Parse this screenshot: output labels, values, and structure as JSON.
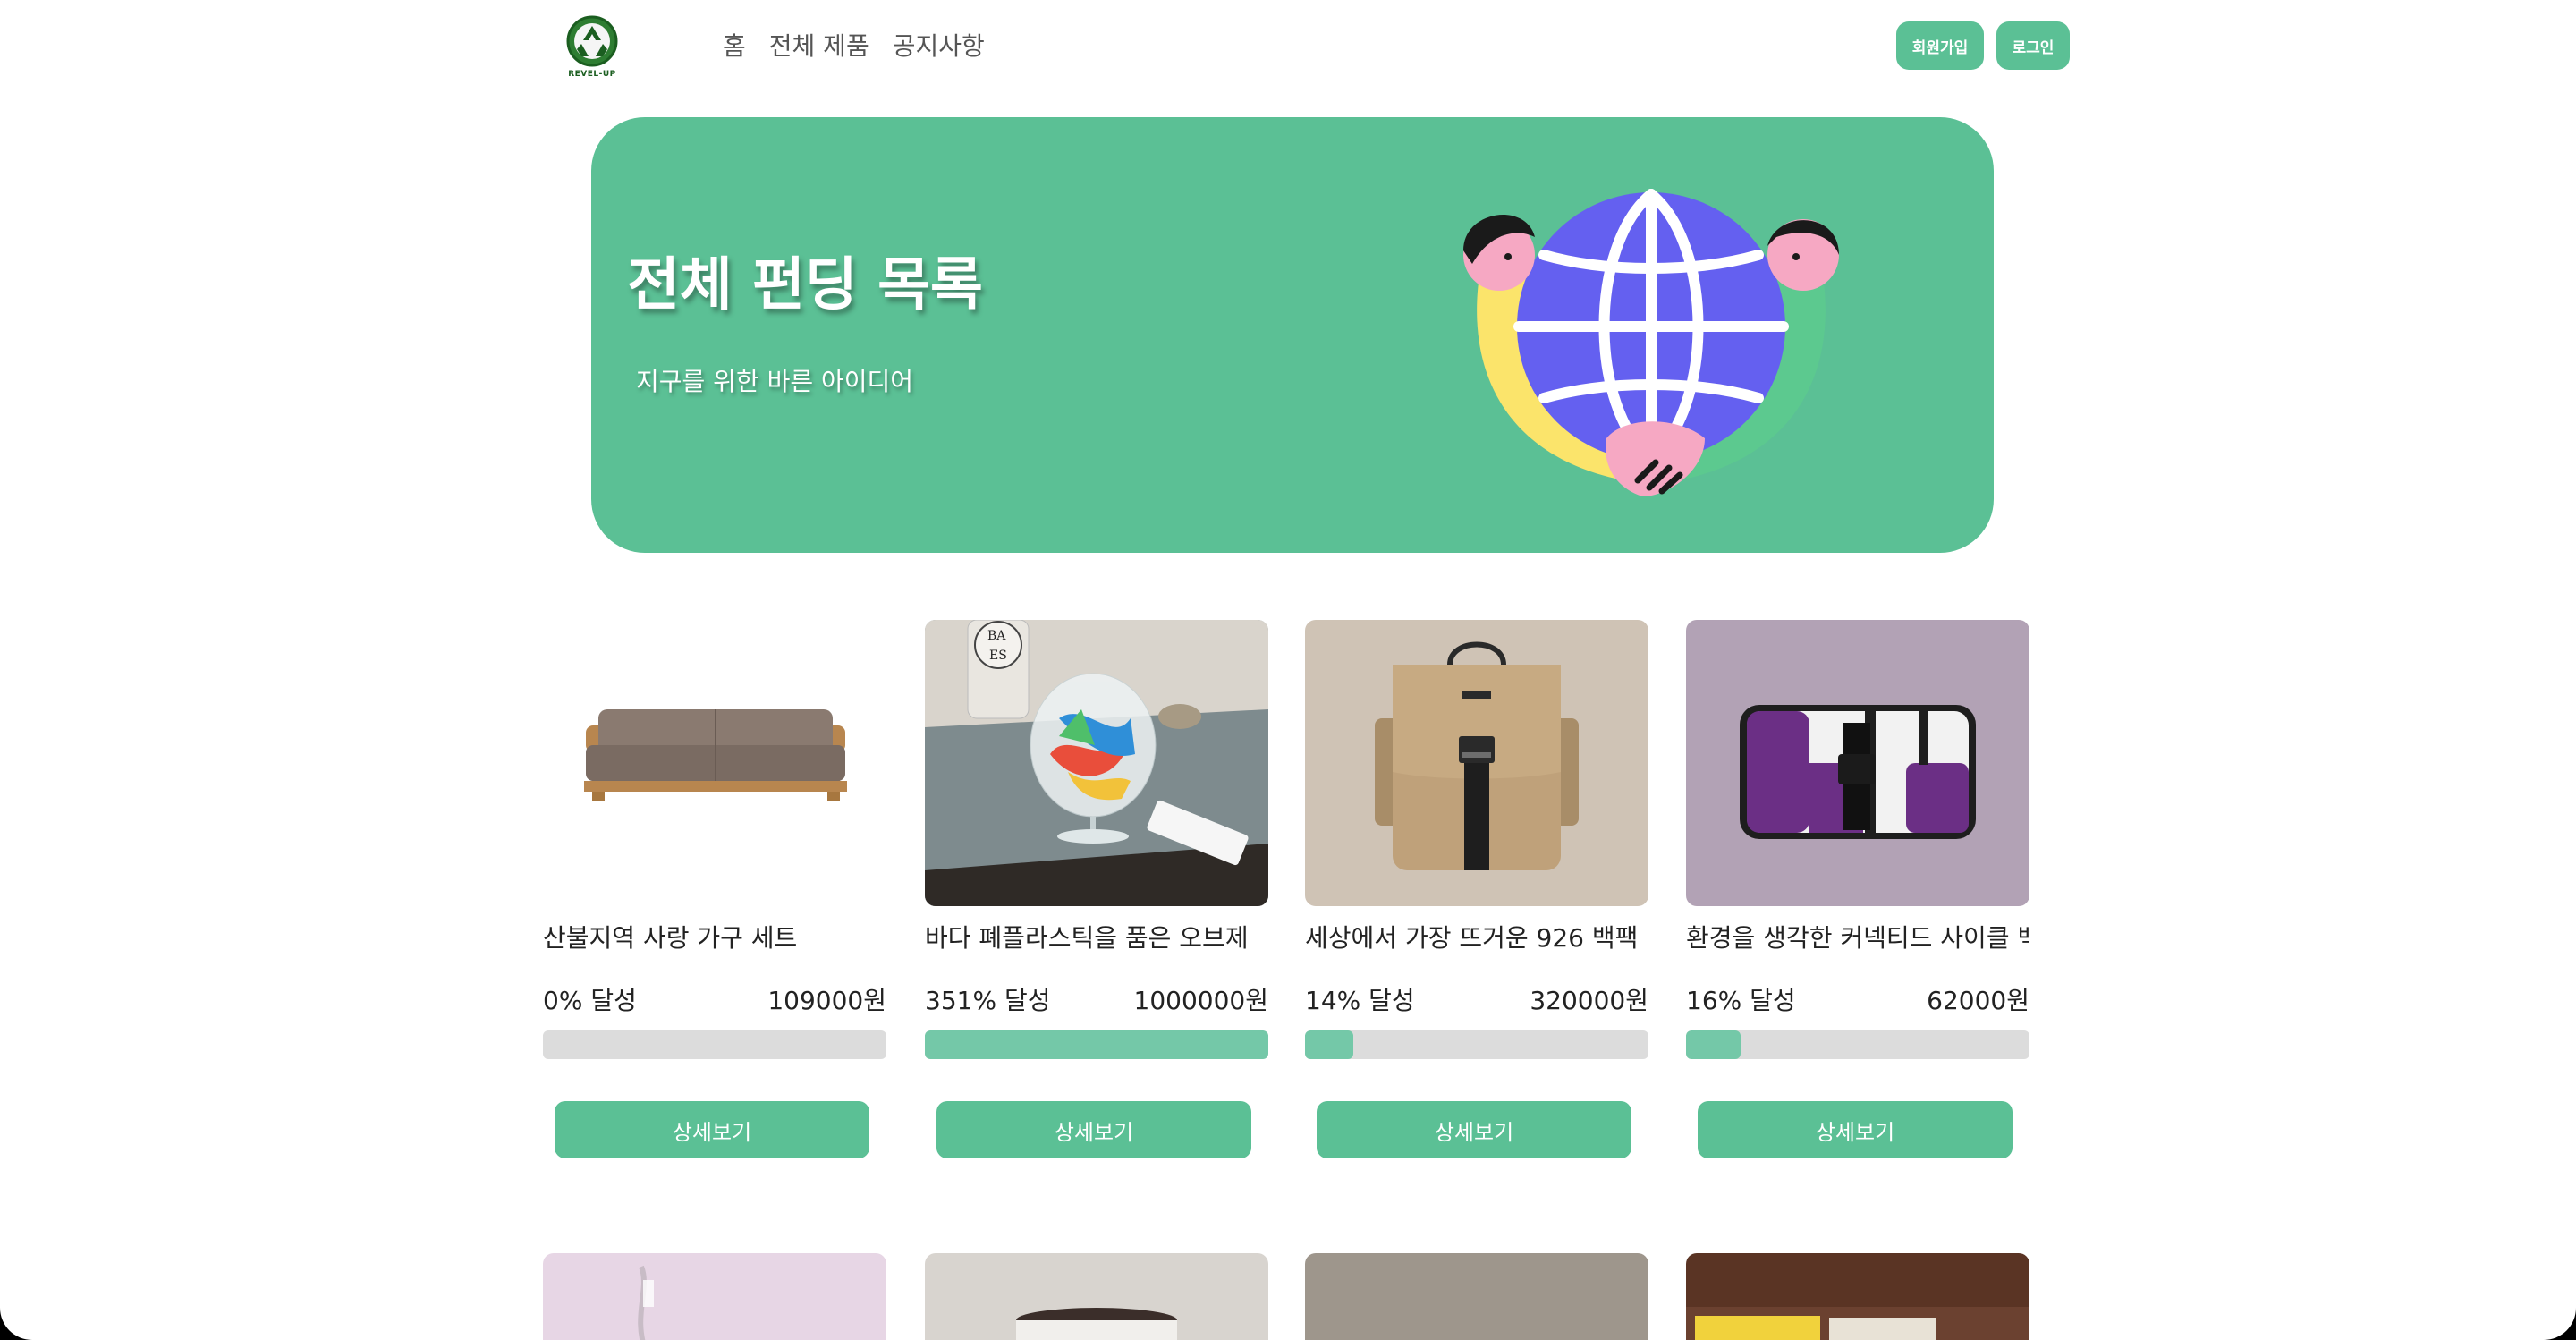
{
  "header": {
    "logo_text": "REVEL-UP",
    "nav": [
      "홈",
      "전체 제품",
      "공지사항"
    ],
    "signup_label": "회원가입",
    "login_label": "로그인"
  },
  "hero": {
    "title": "전체 펀딩 목록",
    "subtitle": "지구를 위한 바른 아이디어"
  },
  "products": [
    {
      "name": "산불지역 사랑 가구 세트",
      "percent_label": "0% 달성",
      "percent": 0,
      "price": "109000원",
      "button": "상세보기",
      "image": "sofa"
    },
    {
      "name": "바다 폐플라스틱을 품은 오브제",
      "percent_label": "351% 달성",
      "percent": 351,
      "price": "1000000원",
      "button": "상세보기",
      "image": "plastic-object"
    },
    {
      "name": "세상에서 가장 뜨거운 926 백팩",
      "percent_label": "14% 달성",
      "percent": 14,
      "price": "320000원",
      "button": "상세보기",
      "image": "backpack"
    },
    {
      "name": "환경을 생각한 커넥티드 사이클 백",
      "percent_label": "16% 달성",
      "percent": 16,
      "price": "62000원",
      "button": "상세보기",
      "image": "messenger-bag"
    }
  ],
  "colors": {
    "accent": "#5bc095",
    "progress_fill": "#74c8a8",
    "progress_track": "#dcdcdc"
  }
}
